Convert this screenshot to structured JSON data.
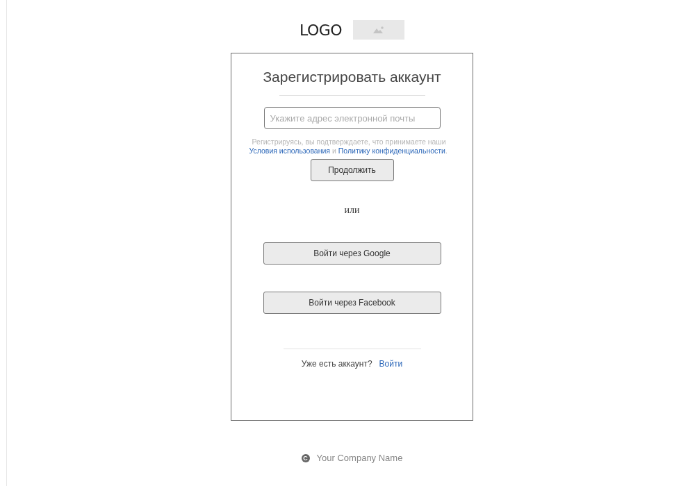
{
  "logo": {
    "text": "LOGO"
  },
  "card": {
    "title": "Зарегистрировать аккаунт",
    "email_field": {
      "placeholder": "Укажите адрес электронной почты"
    },
    "consent": {
      "text_before": "Регистрируясь, вы подтверждаете, что принимаете наши",
      "terms_link": "Условия использования",
      "conjunction": "и",
      "privacy_link": "Политику конфиденциальности",
      "text_after": "."
    },
    "continue_button": "Продолжить",
    "separator": "или",
    "social_buttons": [
      "Войти через Google",
      "Войти через Facebook"
    ],
    "footer": {
      "question": "Уже есть аккаунт?",
      "login_link": "Войти"
    }
  },
  "copyright": {
    "symbol": "C",
    "company": "Your Company Name"
  }
}
